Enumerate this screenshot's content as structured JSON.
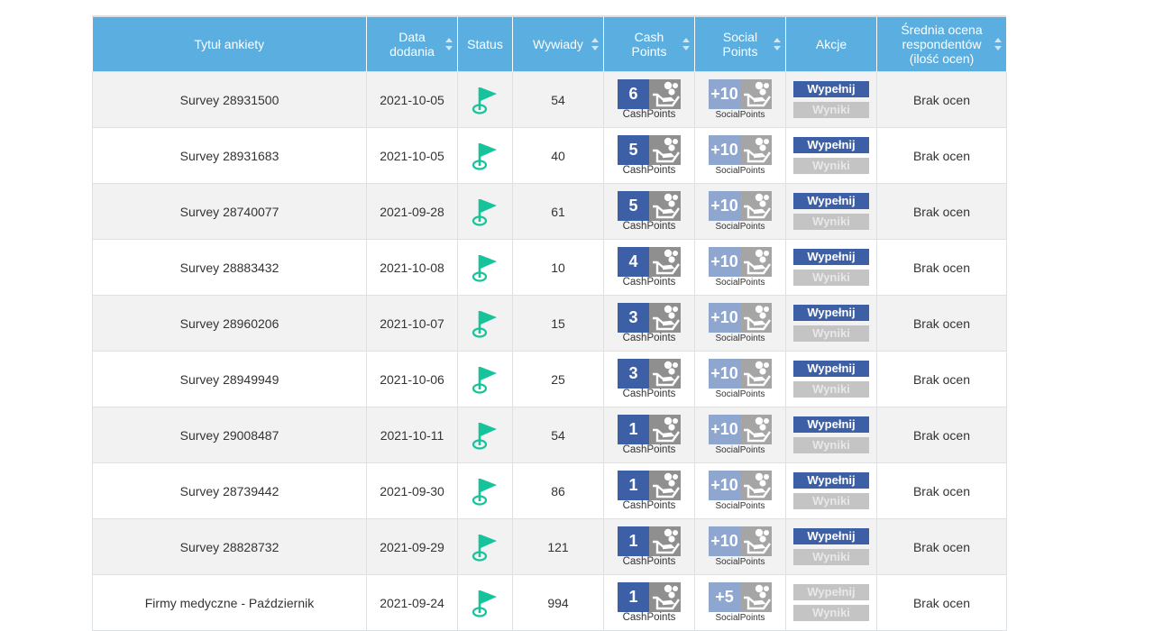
{
  "columns": [
    {
      "label": "Tytuł ankiety",
      "sortable": false
    },
    {
      "label": "Data dodania",
      "sortable": true
    },
    {
      "label": "Status",
      "sortable": false
    },
    {
      "label": "Wywiady",
      "sortable": true
    },
    {
      "label": "Cash Points",
      "sortable": true
    },
    {
      "label": "Social Points",
      "sortable": true
    },
    {
      "label": "Akcje",
      "sortable": false
    },
    {
      "label": "Średnia ocena respondentów (ilość ocen)",
      "sortable": true
    }
  ],
  "labels": {
    "cash": "CashPoints",
    "social": "SocialPoints",
    "fill": "Wypełnij",
    "results": "Wyniki"
  },
  "icons": {
    "status": "flag-icon",
    "cash": "hand-coins-icon",
    "social": "hand-coins-icon"
  },
  "colors": {
    "header": "#5aaee0",
    "status_active": "#17c39a",
    "cash_badge": "#3d5fa6",
    "disabled_button": "#c4c4c4"
  },
  "rows": [
    {
      "title": "Survey 28931500",
      "date": "2021-10-05",
      "interviews": "54",
      "cash": "6",
      "social": "+10",
      "rating": "Brak ocen",
      "fill_enabled": true
    },
    {
      "title": "Survey 28931683",
      "date": "2021-10-05",
      "interviews": "40",
      "cash": "5",
      "social": "+10",
      "rating": "Brak ocen",
      "fill_enabled": true
    },
    {
      "title": "Survey 28740077",
      "date": "2021-09-28",
      "interviews": "61",
      "cash": "5",
      "social": "+10",
      "rating": "Brak ocen",
      "fill_enabled": true
    },
    {
      "title": "Survey 28883432",
      "date": "2021-10-08",
      "interviews": "10",
      "cash": "4",
      "social": "+10",
      "rating": "Brak ocen",
      "fill_enabled": true
    },
    {
      "title": "Survey 28960206",
      "date": "2021-10-07",
      "interviews": "15",
      "cash": "3",
      "social": "+10",
      "rating": "Brak ocen",
      "fill_enabled": true
    },
    {
      "title": "Survey 28949949",
      "date": "2021-10-06",
      "interviews": "25",
      "cash": "3",
      "social": "+10",
      "rating": "Brak ocen",
      "fill_enabled": true
    },
    {
      "title": "Survey 29008487",
      "date": "2021-10-11",
      "interviews": "54",
      "cash": "1",
      "social": "+10",
      "rating": "Brak ocen",
      "fill_enabled": true
    },
    {
      "title": "Survey 28739442",
      "date": "2021-09-30",
      "interviews": "86",
      "cash": "1",
      "social": "+10",
      "rating": "Brak ocen",
      "fill_enabled": true
    },
    {
      "title": "Survey 28828732",
      "date": "2021-09-29",
      "interviews": "121",
      "cash": "1",
      "social": "+10",
      "rating": "Brak ocen",
      "fill_enabled": true
    },
    {
      "title": "Firmy medyczne - Październik",
      "date": "2021-09-24",
      "interviews": "994",
      "cash": "1",
      "social": "+5",
      "rating": "Brak ocen",
      "fill_enabled": false
    }
  ]
}
